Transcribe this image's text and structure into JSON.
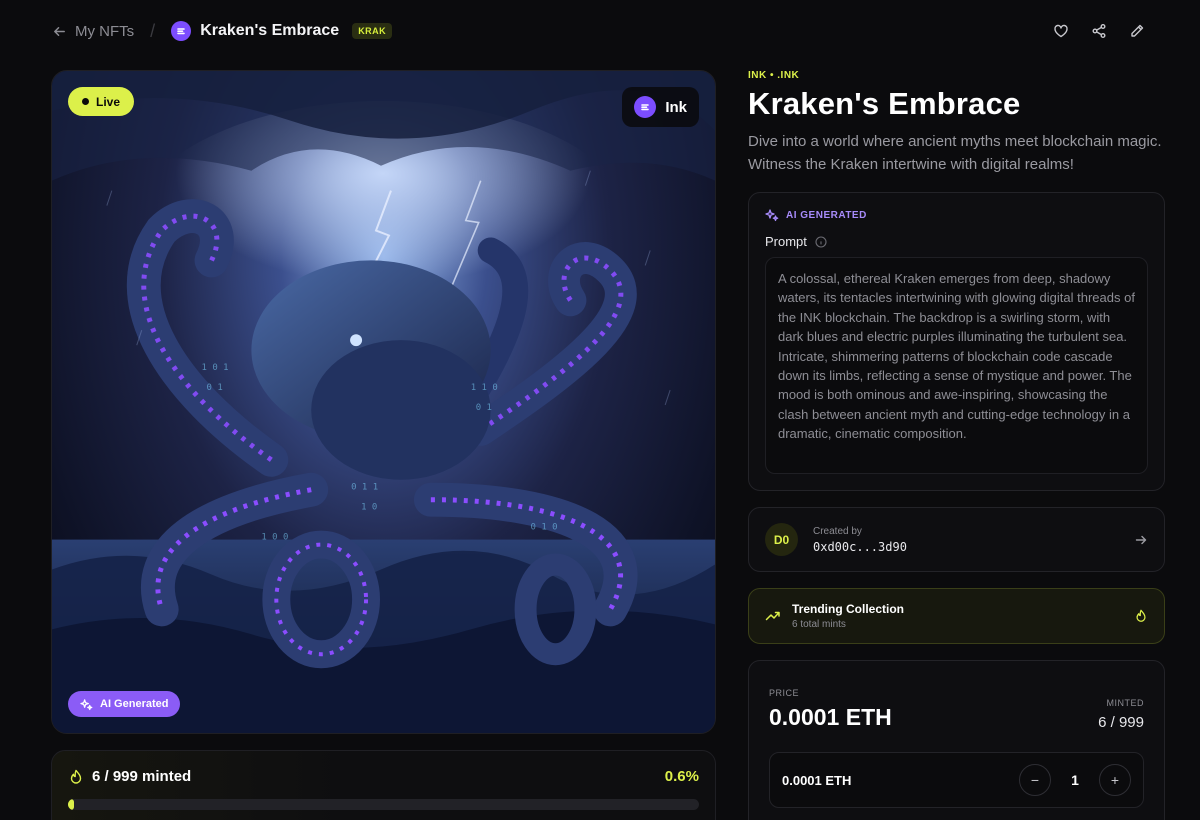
{
  "nav": {
    "back_label": "My NFTs",
    "title": "Kraken's Embrace",
    "ticker": "KRAK"
  },
  "artwork": {
    "status": "Live",
    "chain": "Ink",
    "ai_badge": "AI Generated"
  },
  "mint_progress": {
    "minted_text": "6 / 999 minted",
    "percent_text": "0.6%",
    "fraction": 0.006
  },
  "detail": {
    "chain_tag": "INK • .INK",
    "title": "Kraken's Embrace",
    "description": "Dive into a world where ancient myths meet blockchain magic. Witness the Kraken intertwine with digital realms!"
  },
  "prompt": {
    "ai_label": "AI GENERATED",
    "heading": "Prompt",
    "text": "A colossal, ethereal Kraken emerges from deep, shadowy waters, its tentacles intertwining with glowing digital threads of the INK blockchain. The backdrop is a swirling storm, with dark blues and electric purples illuminating the turbulent sea. Intricate, shimmering patterns of blockchain code cascade down its limbs, reflecting a sense of mystique and power. The mood is both ominous and awe-inspiring, showcasing the clash between ancient myth and cutting-edge technology in a dramatic, cinematic composition."
  },
  "creator": {
    "initials": "D0",
    "label": "Created by",
    "address": "0xd00c...3d90"
  },
  "trending": {
    "title": "Trending Collection",
    "subtitle": "6 total mints"
  },
  "price": {
    "price_label": "PRICE",
    "price_value": "0.0001 ETH",
    "minted_label": "MINTED",
    "minted_value": "6 / 999",
    "qty_price": "0.0001 ETH",
    "quantity": "1",
    "minus": "−",
    "plus": "+"
  },
  "colors": {
    "accent": "#dcf04a",
    "ink_purple": "#7c4dff",
    "ai_purple": "#8b5cf6",
    "background": "#0b0b0d"
  },
  "icons": [
    "arrow-left-icon",
    "ink-logo-icon",
    "heart-icon",
    "share-icon",
    "edit-icon",
    "sparkles-icon",
    "info-icon",
    "arrow-right-icon",
    "trending-up-icon",
    "flame-icon"
  ]
}
